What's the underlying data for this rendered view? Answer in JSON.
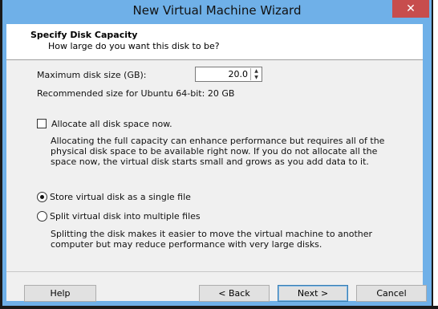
{
  "window": {
    "title": "New Virtual Machine Wizard",
    "close_glyph": "✕"
  },
  "header": {
    "title": "Specify Disk Capacity",
    "subtitle": "How large do you want this disk to be?"
  },
  "disk": {
    "max_size_label": "Maximum disk size (GB):",
    "max_size_value": "20.0",
    "recommended": "Recommended size for Ubuntu 64-bit: 20 GB"
  },
  "allocate": {
    "label": "Allocate all disk space now.",
    "checked": false,
    "description": "Allocating the full capacity can enhance performance but requires all of the\nphysical disk space to be available right now. If you do not allocate all the\nspace now, the virtual disk starts small and grows as you add data to it."
  },
  "storage": {
    "single_label": "Store virtual disk as a single file",
    "multi_label": "Split virtual disk into multiple files",
    "selected": "single",
    "multi_description": "Splitting the disk makes it easier to move the virtual machine to another\ncomputer but may reduce performance with very large disks."
  },
  "buttons": {
    "help": "Help",
    "back": "< Back",
    "next": "Next >",
    "cancel": "Cancel"
  },
  "colors": {
    "titlebar": "#6fb0e8",
    "close": "#c74d4d"
  }
}
